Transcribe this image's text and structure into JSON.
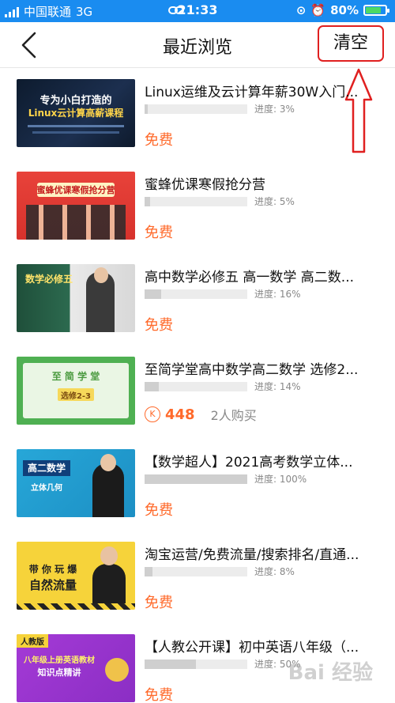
{
  "status_bar": {
    "carrier": "中国联通",
    "network": "3G",
    "time": "21:33",
    "battery": "80%",
    "battery_level": 0.8
  },
  "nav": {
    "title": "最近浏览",
    "clear_label": "清空",
    "back_icon": "chevron-left-icon"
  },
  "thumb_texts": {
    "t1_line1": "专为小白打造的",
    "t1_line2": "Linux云计算高薪课程",
    "t2_line1": "蜜蜂优课寒假抢分营",
    "t3_line1": "数学必修五",
    "t4_line1": "至  简  学  堂",
    "t4_line2": "选修2-3",
    "t5_line1": "高二数学",
    "t5_line2": "立体几何",
    "t6_line1": "带 你 玩 爆",
    "t6_line2": "自然流量",
    "t7_badge": "人教版",
    "t7_line1": "八年级上册英语教材",
    "t7_line2": "知识点精讲"
  },
  "items": [
    {
      "title": "Linux运维及云计算年薪30W入门...",
      "progress_label": "进度: 3%",
      "progress": 0.03,
      "price": "免费"
    },
    {
      "title": "蜜蜂优课寒假抢分营",
      "progress_label": "进度: 5%",
      "progress": 0.05,
      "price": "免费"
    },
    {
      "title": "高中数学必修五 高一数学 高二数...",
      "progress_label": "进度: 16%",
      "progress": 0.16,
      "price": "免费"
    },
    {
      "title": "至简学堂高中数学高二数学 选修2...",
      "progress_label": "进度: 14%",
      "progress": 0.14,
      "coin_symbol": "K",
      "coin_price": "448",
      "buyers": "2人购买"
    },
    {
      "title": "【数学超人】2021高考数学立体...",
      "progress_label": "进度: 100%",
      "progress": 1.0,
      "price": "免费"
    },
    {
      "title": "淘宝运营/免费流量/搜索排名/直通...",
      "progress_label": "进度: 8%",
      "progress": 0.08,
      "price": "免费"
    },
    {
      "title": "【人教公开课】初中英语八年级（...",
      "progress_label": "进度: 50%",
      "progress": 0.5,
      "price": "免费"
    }
  ],
  "watermark": "Bai 经验",
  "colors": {
    "status_bar_bg": "#1a8cf0",
    "price_orange": "#ff6a2b",
    "annotation_red": "#e02020"
  }
}
